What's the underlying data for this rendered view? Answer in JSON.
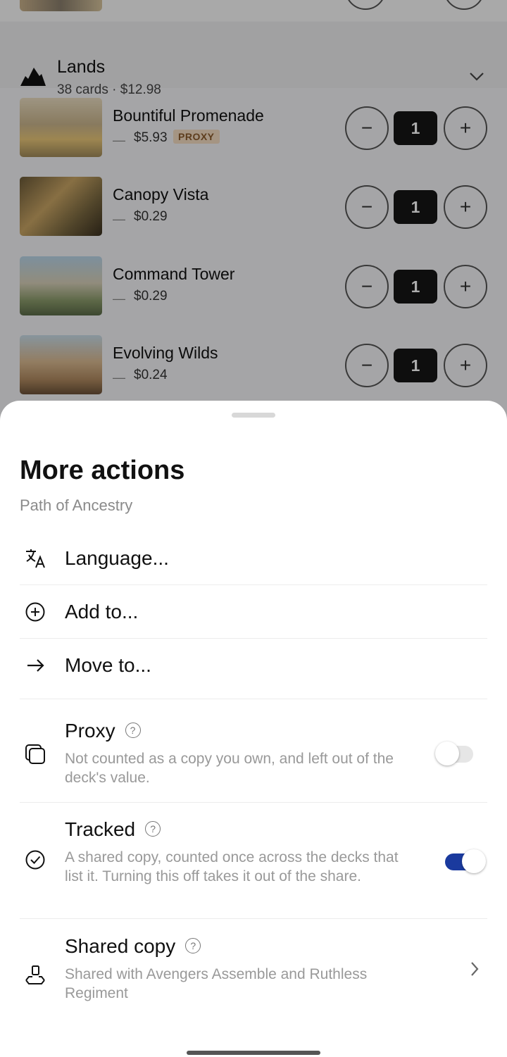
{
  "section": {
    "title": "Lands",
    "summary": "38 cards · $12.98"
  },
  "cards": [
    {
      "name": "Bountiful Promenade",
      "price": "$5.93",
      "badge": "PROXY",
      "qty": "1"
    },
    {
      "name": "Canopy Vista",
      "price": "$0.29",
      "badge": "",
      "qty": "1"
    },
    {
      "name": "Command Tower",
      "price": "$0.29",
      "badge": "",
      "qty": "1"
    },
    {
      "name": "Evolving Wilds",
      "price": "$0.24",
      "badge": "",
      "qty": "1"
    }
  ],
  "controls": {
    "dash": "—",
    "minus": "−",
    "plus": "+"
  },
  "sheet": {
    "title": "More actions",
    "subtitle": "Path of Ancestry",
    "actions": [
      {
        "label": "Language...",
        "icon": "translate-icon"
      },
      {
        "label": "Add to...",
        "icon": "add-circle-icon"
      },
      {
        "label": "Move to...",
        "icon": "arrow-right-icon"
      }
    ],
    "help_glyph": "?",
    "options": [
      {
        "label": "Proxy",
        "description": "Not counted as a copy you own, and left out of the deck's value.",
        "enabled": false,
        "icon": "copies-icon"
      },
      {
        "label": "Tracked",
        "description": "A shared copy, counted once across the decks that list it. Turning this off takes it out of the share.",
        "enabled": true,
        "icon": "check-circle-icon"
      },
      {
        "label": "Shared copy",
        "description": "Shared with Avengers Assemble and Ruthless Regiment",
        "icon": "shared-copy-icon"
      }
    ]
  },
  "colors": {
    "accent": "#1a3a9e",
    "badge_bg": "#f4dcc2",
    "badge_text": "#8a5a2c"
  }
}
